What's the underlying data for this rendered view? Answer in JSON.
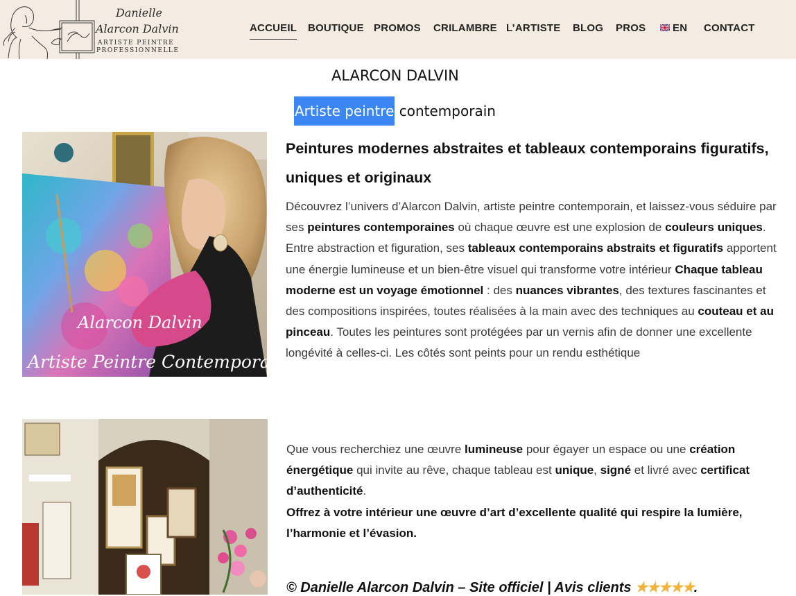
{
  "logo": {
    "name_line1": "Danielle",
    "name_line2": "Alarcon Dalvin",
    "sub_line1": "ARTISTE PEINTRE",
    "sub_line2": "PROFESSIONNELLE"
  },
  "nav": {
    "items": [
      {
        "label": "ACCUEIL",
        "active": true
      },
      {
        "label": "BOUTIQUE"
      },
      {
        "label": "PROMOS"
      },
      {
        "label": "CRILAMBRE"
      },
      {
        "label": "L’ARTISTE"
      },
      {
        "label": "BLOG"
      },
      {
        "label": "PROS"
      },
      {
        "label": "EN",
        "icon": "uk-flag-icon"
      },
      {
        "label": "CONTACT"
      }
    ]
  },
  "hero": {
    "title": "ALARCON DALVIN",
    "subtitle_highlight": "Artiste peintre",
    "subtitle_rest": " contemporain"
  },
  "images": {
    "photo1_caption_line1": "Alarcon Dalvin",
    "photo1_caption_line2": "Artiste Peintre Contemporain"
  },
  "section1": {
    "heading": "Peintures modernes abstraites et tableaux contemporains figuratifs, uniques et originaux",
    "p_t1": "Découvrez l’univers d’Alarcon Dalvin, artiste peintre contemporain, et laissez-vous séduire par ses ",
    "p_b1": "peintures contemporaines",
    "p_t2": " où chaque œuvre est une explosion de ",
    "p_b2": "couleurs uniques",
    "p_t3": ". Entre abstraction et figuration, ses ",
    "p_b3": "tableaux contemporains abstraits et figuratifs",
    "p_t4": " apportent une énergie lumineuse et un bien-être visuel qui transforme votre intérieur ",
    "p_b4": "Chaque tableau moderne est un voyage émotionnel",
    "p_t5": " : des ",
    "p_b5": "nuances vibrantes",
    "p_t6": ", des textures fascinantes et des compositions inspirées, toutes réalisées à la main avec des techniques au ",
    "p_b6": "couteau et au pinceau",
    "p_t7": ". Toutes les peintures sont protégées par un vernis afin de donner une excellente longévité à celles-ci. Les côtés  sont peints pour un rendu esthétique"
  },
  "section2": {
    "t1": "Que vous recherchiez une œuvre  ",
    "b1": "lumineuse",
    "t2": " pour égayer un espace ou une ",
    "b2": "création énergétique",
    "t3": " qui invite au rêve, chaque tableau est ",
    "b3": "unique",
    "t4": ", ",
    "b4": "signé",
    "t5": " et livré avec ",
    "b5": "certificat d’authenticité",
    "t6": ".",
    "strong": "Offrez à votre intérieur une œuvre d’art d’excellente qualité qui respire la lumière, l’harmonie et l’évasion."
  },
  "footer": {
    "copyright": "© Danielle Alarcon Dalvin –  Site officiel",
    "sep": " | ",
    "reviews": "Avis clients ",
    "stars": "★★★★★",
    "end": "."
  },
  "colors": {
    "header_bg": "#f4ece2",
    "highlight": "#3b86f3",
    "star": "#f3b23c"
  }
}
